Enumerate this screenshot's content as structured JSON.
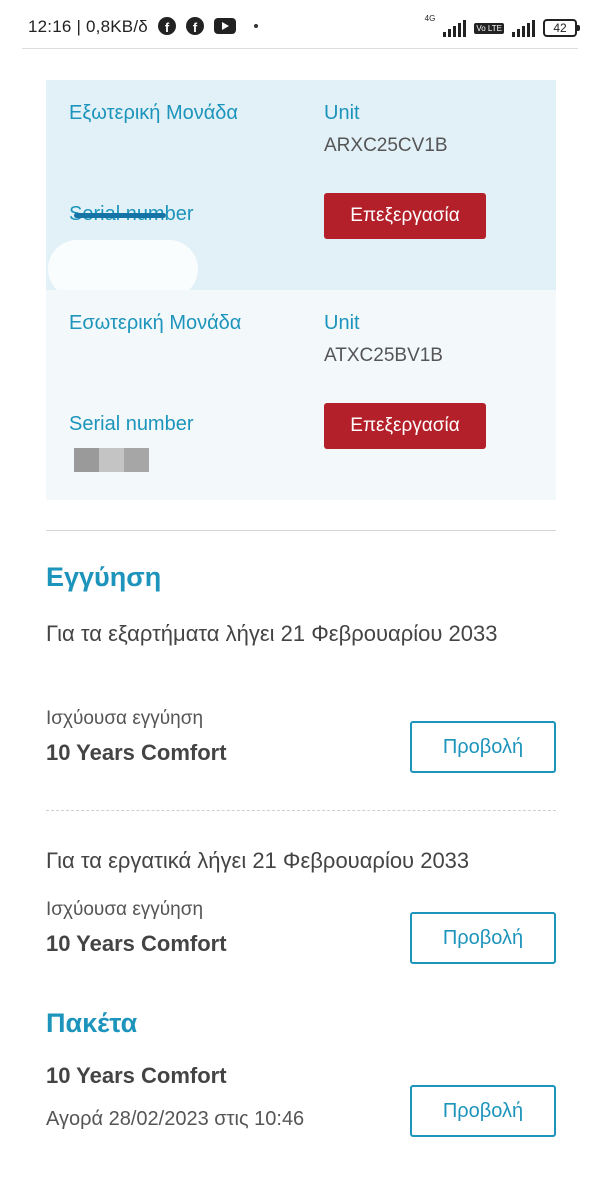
{
  "status_bar": {
    "time": "12:16 | 0,8KB/δ",
    "net_label": "4G",
    "volte": "Vo LTE",
    "battery": "42"
  },
  "units": {
    "outdoor": {
      "label": "Εξωτερική Μονάδα",
      "unit_label": "Unit",
      "unit_code": "ARXC25CV1B",
      "serial_label": "Serial number",
      "edit_label": "Επεξεργασία"
    },
    "indoor": {
      "label": "Εσωτερική Μονάδα",
      "unit_label": "Unit",
      "unit_code": "ATXC25BV1B",
      "serial_label": "Serial number",
      "edit_label": "Επεξεργασία"
    }
  },
  "warranty": {
    "title": "Εγγύηση",
    "parts": {
      "text": "Για τα εξαρτήματα λήγει 21 Φεβρουαρίου 2033",
      "valid_label": "Ισχύουσα εγγύηση",
      "plan": "10 Years Comfort",
      "view_label": "Προβολή"
    },
    "labor": {
      "text": "Για τα εργατικά λήγει 21 Φεβρουαρίου 2033",
      "valid_label": "Ισχύουσα εγγύηση",
      "plan": "10 Years Comfort",
      "view_label": "Προβολή"
    }
  },
  "packages": {
    "title": "Πακέτα",
    "item": {
      "name": "10 Years Comfort",
      "purchase": "Αγορά 28/02/2023 στις 10:46",
      "view_label": "Προβολή"
    }
  }
}
